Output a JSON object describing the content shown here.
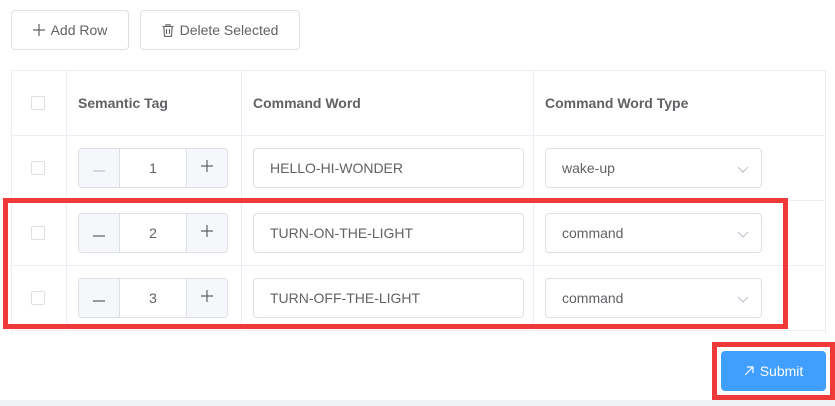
{
  "toolbar": {
    "add_label": "Add Row",
    "delete_label": "Delete Selected"
  },
  "table": {
    "headers": {
      "semantic_tag": "Semantic Tag",
      "command_word": "Command Word",
      "command_word_type": "Command Word Type"
    },
    "rows": [
      {
        "tag": "1",
        "word": "HELLO-HI-WONDER",
        "type": "wake-up",
        "minus_disabled": true
      },
      {
        "tag": "2",
        "word": "TURN-ON-THE-LIGHT",
        "type": "command",
        "minus_disabled": false
      },
      {
        "tag": "3",
        "word": "TURN-OFF-THE-LIGHT",
        "type": "command",
        "minus_disabled": false
      }
    ]
  },
  "submit": {
    "label": "Submit"
  },
  "colors": {
    "primary": "#409eff",
    "highlight": "#f03a3a",
    "border": "#dcdfe6"
  }
}
